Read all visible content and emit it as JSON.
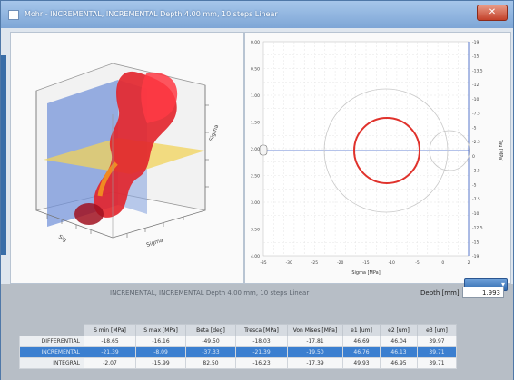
{
  "window": {
    "title": "Mohr - INCREMENTAL, INCREMENTAL Depth 4.00 mm, 10 steps Linear",
    "close_label": "✕"
  },
  "view3d": {
    "axis_labels": [
      "Sigma",
      "Sigma",
      "Sig"
    ]
  },
  "mohr": {
    "left_ticks": [
      "0.00",
      "0.50",
      "1.00",
      "1.50",
      "2.00",
      "2.50",
      "3.00",
      "3.50",
      "4.00"
    ],
    "right_ticks": [
      "-19",
      "-15",
      "-13.5",
      "-12",
      "-10",
      "-7.5",
      "-5",
      "-2.5",
      "0",
      "-2.5",
      "-5",
      "-7.5",
      "-10",
      "-12.5",
      "-15",
      "-19"
    ],
    "right_axis_title": "Tau [MPa]",
    "bottom_ticks": [
      "-35",
      "-30",
      "-25",
      "-20",
      "-15",
      "-10",
      "-5",
      "0",
      "2"
    ],
    "xlabel": "Sigma [MPa]",
    "colors": {
      "circle_active": "#e0322c",
      "circle_inactive": "#bbbbbb",
      "axis_line": "#3a5fc8"
    }
  },
  "results": {
    "center_title": "INCREMENTAL, INCREMENTAL Depth 4.00 mm, 10 steps Linear",
    "depth_label": "Depth [mm]",
    "depth_value": "1.993",
    "columns": [
      "S min [MPa]",
      "S max [MPa]",
      "Beta [deg]",
      "Tresca [MPa]",
      "Von Mises [MPa]",
      "e1 [um]",
      "e2 [um]",
      "e3 [um]"
    ],
    "rows": [
      {
        "label": "DIFFERENTIAL",
        "values": [
          "-18.65",
          "-16.16",
          "-49.50",
          "-18.03",
          "-17.81",
          "46.69",
          "46.04",
          "39.97"
        ]
      },
      {
        "label": "INCREMENTAL",
        "values": [
          "-21.39",
          "-8.09",
          "-37.33",
          "-21.39",
          "-19.50",
          "46.76",
          "46.13",
          "39.71"
        ]
      },
      {
        "label": "INTEGRAL",
        "values": [
          "-2.07",
          "-15.99",
          "82.50",
          "-16.23",
          "-17.39",
          "49.93",
          "46.95",
          "39.71"
        ]
      }
    ],
    "selected_row": 1
  }
}
